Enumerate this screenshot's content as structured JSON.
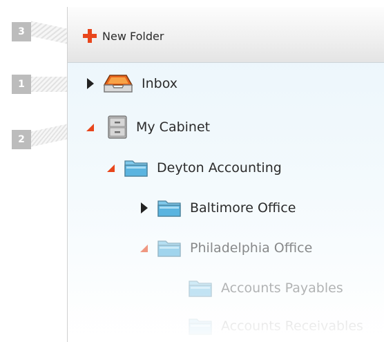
{
  "callouts": [
    "3",
    "1",
    "2"
  ],
  "toolbar": {
    "new_folder_label": "New Folder"
  },
  "tree": [
    {
      "label": "Inbox",
      "icon": "inbox-tray-icon",
      "state": "collapsed"
    },
    {
      "label": "My Cabinet",
      "icon": "cabinet-icon",
      "state": "expanded"
    },
    {
      "label": "Deyton Accounting",
      "icon": "folder-icon",
      "state": "expanded"
    },
    {
      "label": "Baltimore Office",
      "icon": "folder-icon",
      "state": "collapsed"
    },
    {
      "label": "Philadelphia Office",
      "icon": "folder-icon",
      "state": "expanded"
    },
    {
      "label": "Accounts Payables",
      "icon": "folder-icon",
      "state": "none"
    },
    {
      "label": "Accounts Receivables",
      "icon": "folder-icon",
      "state": "none"
    }
  ],
  "colors": {
    "accent": "#e8461c",
    "folder": "#5ab4e0",
    "panel_bg": "#eaf5fb",
    "callout": "#bcbcbc"
  }
}
